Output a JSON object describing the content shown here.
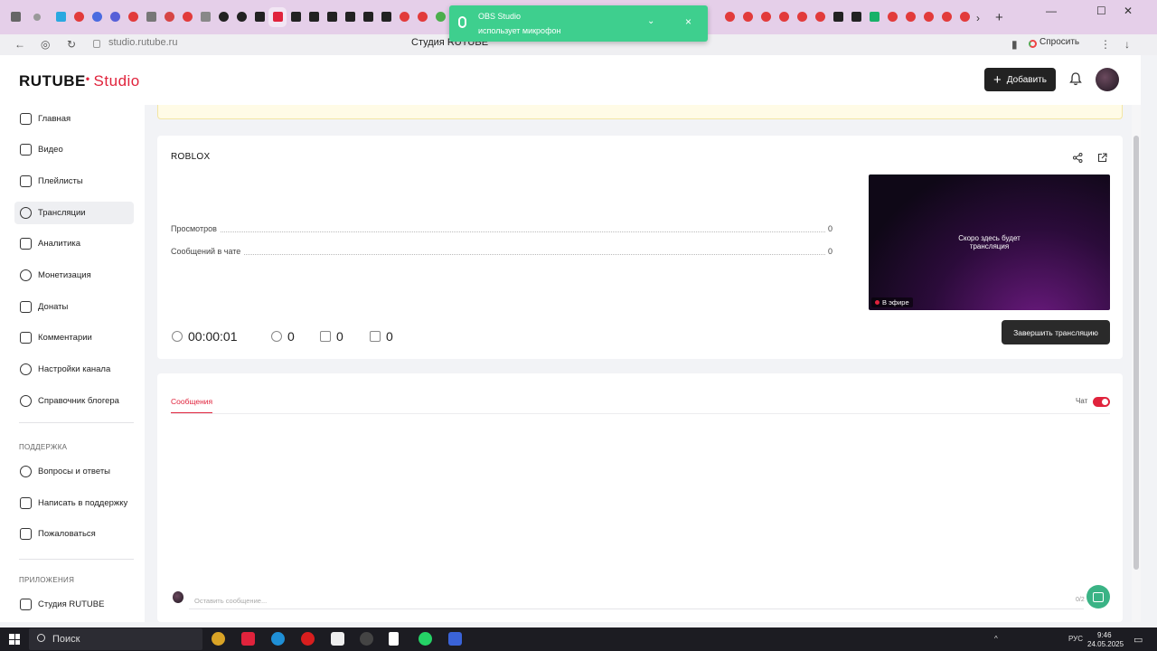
{
  "browser": {
    "url": "studio.rutube.ru",
    "page_title": "Студия RUTUBE",
    "ask_label": "Спросить",
    "window_controls": {
      "minimize": "—",
      "maximize": "☐",
      "close": "✕"
    }
  },
  "toast": {
    "app": "OBS Studio",
    "message": "использует микрофон"
  },
  "header": {
    "logo_main": "RUTUBE",
    "logo_sub": "Studio",
    "add_label": "Добавить"
  },
  "sidebar": {
    "items": [
      {
        "label": "Главная",
        "icon": "home-icon"
      },
      {
        "label": "Видео",
        "icon": "video-icon"
      },
      {
        "label": "Плейлисты",
        "icon": "playlist-icon"
      },
      {
        "label": "Трансляции",
        "icon": "broadcast-icon",
        "active": true
      },
      {
        "label": "Аналитика",
        "icon": "analytics-icon"
      },
      {
        "label": "Монетизация",
        "icon": "money-icon"
      },
      {
        "label": "Донаты",
        "icon": "donation-icon"
      },
      {
        "label": "Комментарии",
        "icon": "comment-icon"
      },
      {
        "label": "Настройки канала",
        "icon": "gear-icon"
      },
      {
        "label": "Справочник блогера",
        "icon": "globe-icon"
      }
    ],
    "support_heading": "ПОДДЕРЖКА",
    "support_items": [
      {
        "label": "Вопросы и ответы",
        "icon": "question-icon"
      },
      {
        "label": "Написать в поддержку",
        "icon": "mail-icon"
      },
      {
        "label": "Пожаловаться",
        "icon": "flag-icon"
      }
    ],
    "apps_heading": "ПРИЛОЖЕНИЯ",
    "apps_items": [
      {
        "label": "Студия RUTUBE",
        "icon": "app-icon"
      }
    ]
  },
  "stream": {
    "title": "ROBLOX",
    "stats": [
      {
        "label": "Просмотров",
        "value": "0"
      },
      {
        "label": "Сообщений в чате",
        "value": "0"
      }
    ],
    "duration": "00:00:01",
    "viewers": "0",
    "likes": "0",
    "dislikes": "0",
    "preview_text_1": "Скоро здесь будет",
    "preview_text_2": "трансляция",
    "live_label": "В эфире",
    "end_label": "Завершить трансляцию"
  },
  "chat": {
    "tab_label": "Сообщения",
    "chat_toggle_label": "Чат",
    "chat_enabled": true,
    "input_placeholder": "Оставить сообщение...",
    "char_count": "0/2"
  },
  "taskbar": {
    "search_label": "Поиск",
    "lang": "РУС",
    "time": "9:46",
    "date": "24.05.2025"
  }
}
